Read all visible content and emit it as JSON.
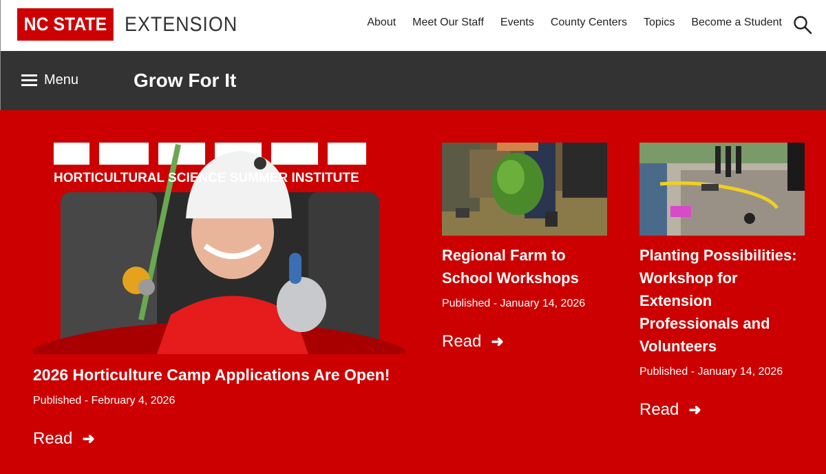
{
  "brand": {
    "mark": "NC STATE",
    "unit": "EXTENSION"
  },
  "topnav": [
    {
      "label": "About"
    },
    {
      "label": "Meet Our Staff"
    },
    {
      "label": "Events"
    },
    {
      "label": "County Centers"
    },
    {
      "label": "Topics"
    },
    {
      "label": "Become a Student"
    }
  ],
  "search": {
    "icon": "search-icon"
  },
  "subbar": {
    "menu_label": "Menu",
    "site_title": "Grow For It"
  },
  "colors": {
    "brand_red": "#cc0000",
    "dark_bar": "#333333",
    "white": "#ffffff"
  },
  "cards": [
    {
      "image_text": "HORTICULTURAL SCIENCE SUMMER INSTITUTE",
      "title": "2026 Horticulture Camp Applications Are Open!",
      "published": "Published - February 4, 2026",
      "read": "Read"
    },
    {
      "title": "Regional Farm to School Workshops",
      "published": "Published - January 14, 2026",
      "read": "Read"
    },
    {
      "title": "Planting Possibilities: Workshop for Extension Professionals and Volunteers",
      "published": "Published - January 14, 2026",
      "read": "Read"
    }
  ]
}
